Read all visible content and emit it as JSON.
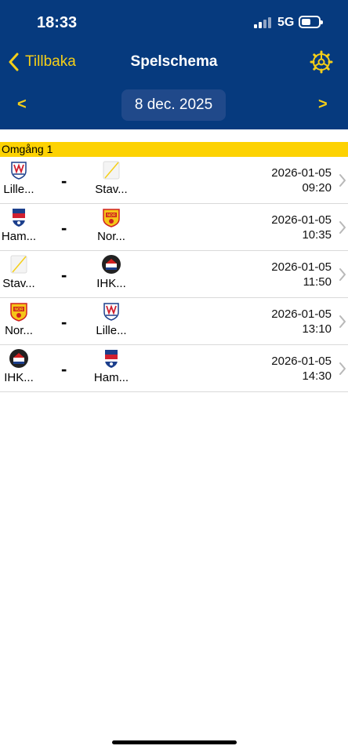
{
  "status": {
    "time": "18:33",
    "network": "5G"
  },
  "nav": {
    "back_label": "Tillbaka",
    "title": "Spelschema",
    "prev": "<",
    "next": ">",
    "date": "8 dec. 2025"
  },
  "round_label": "Omgång 1",
  "matches": [
    {
      "home": "Lille...",
      "home_icon": "lillehammer-logo-icon",
      "away": "Stav...",
      "away_icon": "stavanger-logo-icon",
      "separator": "-",
      "date": "2026-01-05",
      "time": "09:20"
    },
    {
      "home": "Ham...",
      "home_icon": "hamar-logo-icon",
      "away": "Nor...",
      "away_icon": "nor-logo-icon",
      "separator": "-",
      "date": "2026-01-05",
      "time": "10:35"
    },
    {
      "home": "Stav...",
      "home_icon": "stavanger-logo-icon",
      "away": "IHK...",
      "away_icon": "ihk-logo-icon",
      "separator": "-",
      "date": "2026-01-05",
      "time": "11:50"
    },
    {
      "home": "Nor...",
      "home_icon": "nor-logo-icon",
      "away": "Lille...",
      "away_icon": "lillehammer-logo-icon",
      "separator": "-",
      "date": "2026-01-05",
      "time": "13:10"
    },
    {
      "home": "IHK...",
      "home_icon": "ihk-logo-icon",
      "away": "Ham...",
      "away_icon": "hamar-logo-icon",
      "separator": "-",
      "date": "2026-01-05",
      "time": "14:30"
    }
  ],
  "colors": {
    "header": "#063a7e",
    "accent": "#f5cf18",
    "round_bar": "#fdd202"
  }
}
